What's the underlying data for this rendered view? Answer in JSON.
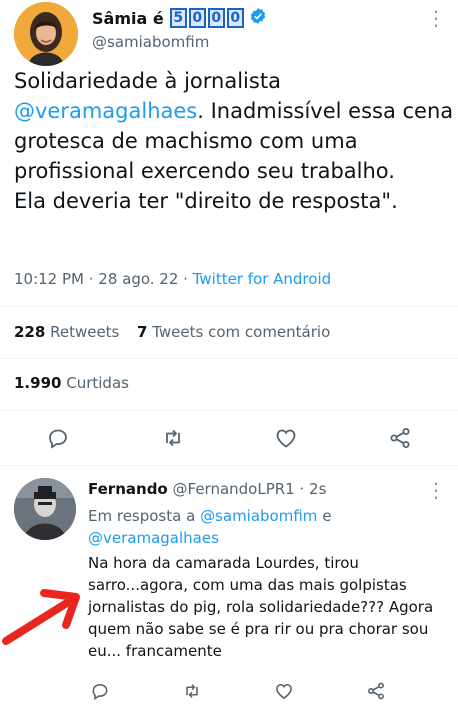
{
  "tweet": {
    "display_name": "Sâmia é",
    "badge_digits": [
      "5",
      "0",
      "0",
      "0"
    ],
    "handle": "@samiabomfim",
    "text_line1": "Solidariedade à jornalista",
    "mention": "@veramagalhaes",
    "text_rest": ". Inadmissível essa cena grotesca de machismo com uma profissional exercendo seu trabalho.",
    "text_line_last": "Ela deveria ter \"direito de resposta\".",
    "time": "10:12 PM · 28 ago. 22 · ",
    "source": "Twitter for Android",
    "retweets_count": "228",
    "retweets_label": "Retweets",
    "quotes_count": "7",
    "quotes_label": "Tweets com comentário",
    "likes_count": "1.990",
    "likes_label": "Curtidas"
  },
  "reply": {
    "name": "Fernando",
    "handle_time": "@FernandoLPR1 · 2s",
    "in_reply_prefix": "Em resposta a ",
    "mention1": "@samiabomfim",
    "conj": " e",
    "mention2": "@veramagalhaes",
    "text": "Na hora da camarada Lourdes, tirou sarro...agora, com uma das mais golpistas jornalistas do pig, rola solidariedade??? Agora quem não sabe se é pra rir ou pra chorar sou eu... francamente"
  },
  "colors": {
    "link": "#1d9bf0",
    "badge": "#1b63c9",
    "annotation_arrow": "#e8261f"
  },
  "icons": [
    "verified-icon",
    "more-icon",
    "reply-icon",
    "retweet-icon",
    "like-icon",
    "share-icon"
  ]
}
